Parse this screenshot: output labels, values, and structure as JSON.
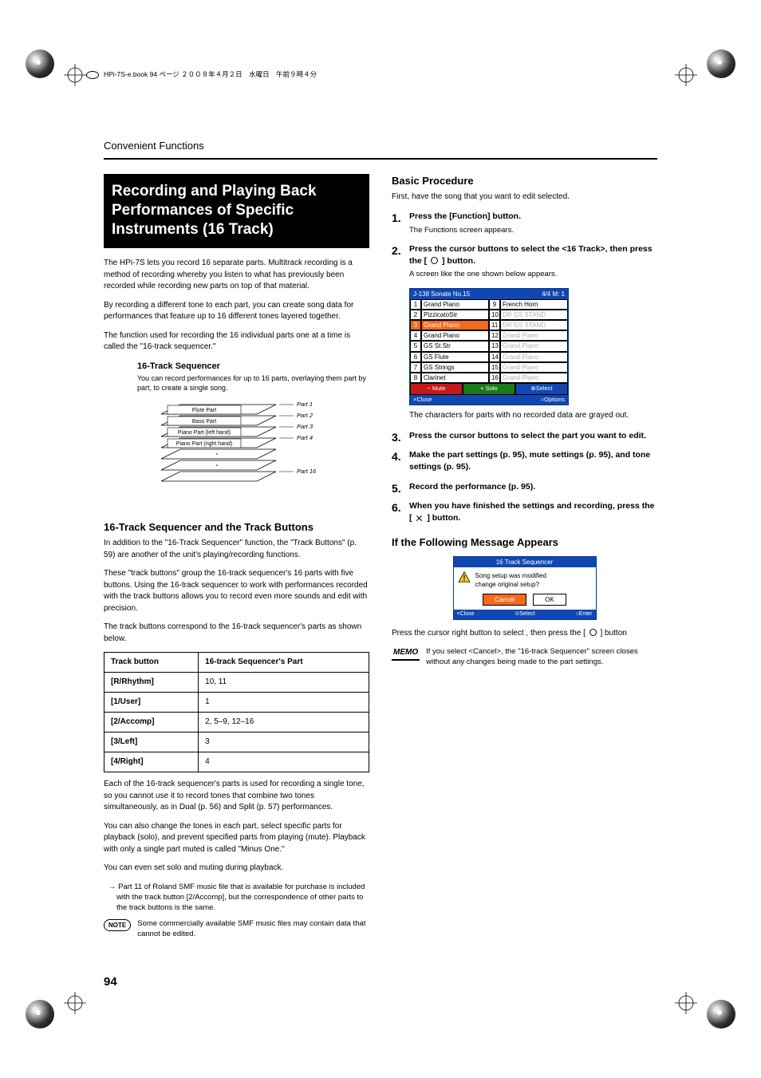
{
  "header_bar": "HPi-7S-e.book  94 ページ  ２００８年４月２日　水曜日　午前９時４分",
  "section_label": "Convenient Functions",
  "page_number": "94",
  "left": {
    "main_heading": "Recording and Playing Back Performances of Specific Instruments (16 Track)",
    "p1": "The HPi-7S lets you record 16 separate parts. Multitrack recording is a method of recording whereby you listen to what has previously been recorded while recording new parts on top of that material.",
    "p2": "By recording a different tone to each part, you can create song data for performances that feature up to 16 different tones layered together.",
    "p3": "The function used for recording the 16 individual parts one at a time is called the \"16-track sequencer.\"",
    "inset_heading": "16-Track Sequencer",
    "inset_caption": "You can record performances for up to 16 parts, overlaying them part by part, to create a single song.",
    "diagram": {
      "labels": [
        "Flute Part",
        "Bass Part",
        "Piano Part (left hand)",
        "Piano Part (right hand)"
      ],
      "parts": [
        "Part 1",
        "Part 2",
        "Part 3",
        "Part 4",
        "Part 16"
      ]
    },
    "sub_heading": "16-Track Sequencer and the Track Buttons",
    "p4": "In addition to the \"16-Track Sequencer\" function, the \"Track Buttons\" (p. 59) are another of the unit's playing/recording functions.",
    "p5": "These \"track buttons\" group the 16-track sequencer's 16 parts with five buttons. Using the 16-track sequencer to work with performances recorded with the track buttons allows you to record even more sounds and edit with precision.",
    "p6": "The track buttons correspond to the 16-track sequencer's parts as shown below.",
    "table": {
      "headers": [
        "Track button",
        "16-track Sequencer's Part"
      ],
      "rows": [
        [
          "[R/Rhythm]",
          "10, 11"
        ],
        [
          "[1/User]",
          "1"
        ],
        [
          "[2/Accomp]",
          "2, 5–9, 12–16"
        ],
        [
          "[3/Left]",
          "3"
        ],
        [
          "[4/Right]",
          "4"
        ]
      ]
    },
    "p7": "Each of the 16-track sequencer's parts is used for recording a single tone, so you cannot use it to record tones that combine two tones simultaneously, as in Dual (p. 56) and Split (p. 57) performances.",
    "p8": "You can also change the tones in each part, select specific parts for playback (solo), and prevent specified parts from playing (mute). Playback with only a single part muted is called \"Minus One.\"",
    "p9": "You can even set solo and muting during playback.",
    "arrow_note": "Part 11 of Roland SMF music file that is available for purchase is included with the track button [2/Accomp], but the correspondence of other parts to the track buttons is the same.",
    "note_text": "Some commercially available SMF music files may contain data that cannot be edited."
  },
  "right": {
    "h_basic": "Basic Procedure",
    "intro": "First, have the song that you want to edit selected.",
    "steps": [
      {
        "title": "Press the [Function] button.",
        "sub": "The Functions screen appears."
      },
      {
        "title": "Press the cursor buttons to select the <16 Track>, then press the [ ○ ] button.",
        "sub": "A screen like the one shown below appears.",
        "circle": true
      },
      {
        "title": "Press the cursor buttons to select the part you want to edit."
      },
      {
        "title": "Make the part settings (p. 95), mute settings (p. 95), and tone settings (p. 95)."
      },
      {
        "title": "Record the performance (p. 95)."
      },
      {
        "title": "When you have finished the settings and recording, press the [ × ] button.",
        "x": true
      }
    ],
    "screenshot": {
      "title_left": "J-138 Sonate No.15",
      "title_right": "4/4  M:   1",
      "rows": [
        {
          "n": "1",
          "name": "Grand Piano",
          "gray": false,
          "n2": "9",
          "name2": "French Horn",
          "gray2": false
        },
        {
          "n": "2",
          "name": "PizzicatoStr",
          "gray": false,
          "n2": "10",
          "name2": "DR GS STAND",
          "gray2": true
        },
        {
          "n": "3",
          "name": "Grand Piano",
          "gray": false,
          "sel": true,
          "n2": "11",
          "name2": "DR GS STAND",
          "gray2": true
        },
        {
          "n": "4",
          "name": "Grand Piano",
          "gray": false,
          "n2": "12",
          "name2": "Grand Piano",
          "gray2": true
        },
        {
          "n": "5",
          "name": "GS St.Str",
          "gray": false,
          "n2": "13",
          "name2": "Grand Piano",
          "gray2": true
        },
        {
          "n": "6",
          "name": "GS Flute",
          "gray": false,
          "n2": "14",
          "name2": "Grand Piano",
          "gray2": true
        },
        {
          "n": "7",
          "name": "GS Strings",
          "gray": false,
          "n2": "15",
          "name2": "Grand Piano",
          "gray2": true
        },
        {
          "n": "8",
          "name": "Clarinet",
          "gray": false,
          "n2": "16",
          "name2": "Grand Piano",
          "gray2": true
        }
      ],
      "foot1": [
        "− Mute",
        "+ Solo",
        "⊗Select"
      ],
      "foot2": [
        "×Close",
        "○Options"
      ]
    },
    "after_screen": "The characters for parts with no recorded data are grayed out.",
    "h_msg": "If the Following Message Appears",
    "dialog": {
      "title": "16 Track Sequencer",
      "body": "Song setup was modified\nchange original setup?",
      "cancel": "Cancel",
      "ok": "OK",
      "foot": [
        "×Close",
        "⊙Select",
        "○Enter"
      ]
    },
    "after_dialog": "Press the cursor right button to select <OK>, then press the [ ○ ] button",
    "memo_text": "If you select <Cancel>, the \"16-track Sequencer\" screen closes without any changes being made to the part settings."
  }
}
